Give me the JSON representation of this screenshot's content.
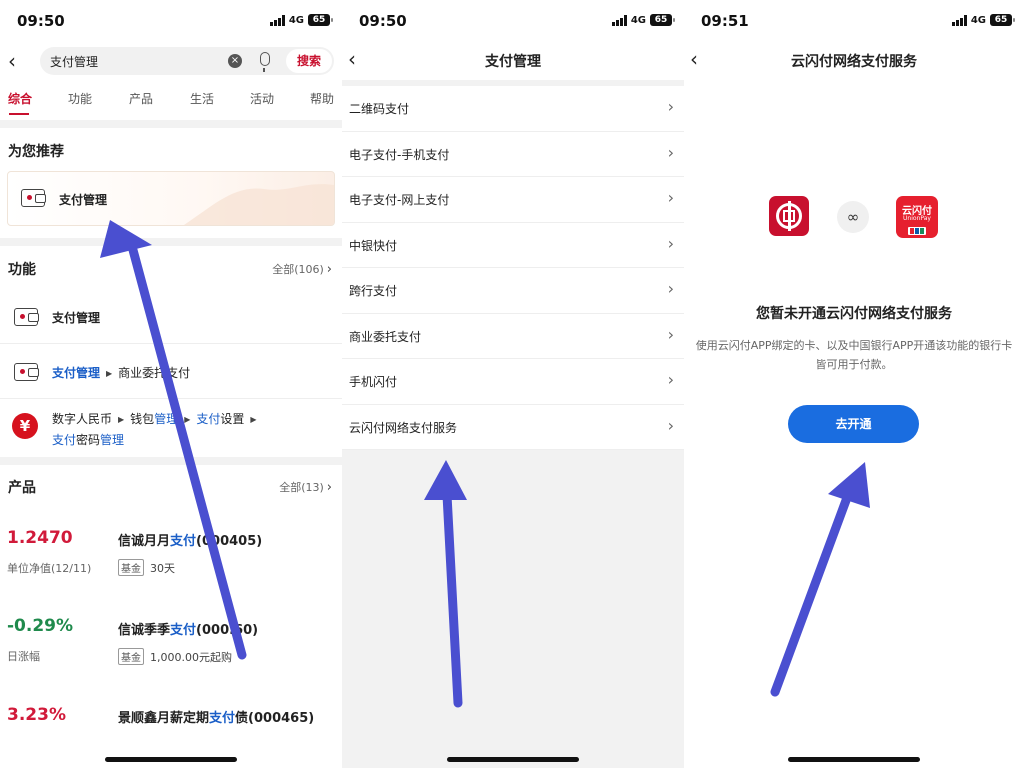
{
  "panel1": {
    "status": {
      "time": "09:50",
      "network": "4G",
      "battery": "65"
    },
    "search": {
      "query": "支付管理",
      "clear": "×",
      "button": "搜索"
    },
    "tabs": [
      "综合",
      "功能",
      "产品",
      "生活",
      "活动",
      "帮助"
    ],
    "recommend": {
      "title": "为您推荐",
      "item": "支付管理"
    },
    "functions": {
      "title": "功能",
      "more": "全部(106)",
      "item1": "支付管理",
      "item2": {
        "a": "支付管理",
        "b": "商业委托支付"
      },
      "item3": {
        "a1": "数字人民币",
        "b1": "钱包",
        "b2": "管理",
        "c1": "支付",
        "c2": "设置",
        "d1": "支付",
        "d2": "密码",
        "d3": "管理"
      },
      "yuan_glyph": "¥"
    },
    "products": {
      "title": "产品",
      "more": "全部(13)",
      "items": [
        {
          "value": "1.2470",
          "sub": "单位净值(12/11)",
          "name_a": "信诚月月",
          "name_b": "支付",
          "name_c": "(000405)",
          "tag": "基金",
          "tag_text": "30天"
        },
        {
          "value": "-0.29%",
          "sub": "日涨幅",
          "name_a": "信诚季季",
          "name_b": "支付",
          "name_c": "(000.60)",
          "tag": "基金",
          "tag_text": "1,000.00元起购"
        },
        {
          "value": "3.23%",
          "sub": "",
          "name_a": "景顺鑫月薪定期",
          "name_b": "支付",
          "name_c": "债(000465)",
          "tag": "",
          "tag_text": ""
        }
      ]
    }
  },
  "panel2": {
    "status": {
      "time": "09:50",
      "network": "4G",
      "battery": "65"
    },
    "title": "支付管理",
    "items": [
      "二维码支付",
      "电子支付-手机支付",
      "电子支付-网上支付",
      "中银快付",
      "跨行支付",
      "商业委托支付",
      "手机闪付",
      "云闪付网络支付服务"
    ]
  },
  "panel3": {
    "status": {
      "time": "09:51",
      "network": "4G",
      "battery": "65"
    },
    "title": "云闪付网络支付服务",
    "logo_cn": "云闪付",
    "logo_en": "UnionPay",
    "heading": "您暂未开通云闪付网络支付服务",
    "description": "使用云闪付APP绑定的卡、以及中国银行APP开通该功能的银行卡皆可用于付款。",
    "button": "去开通"
  },
  "colors": {
    "brand_red": "#c8102e",
    "link_blue": "#1a5ec7",
    "button_blue": "#1a6de0",
    "arrow": "#4a4fd0",
    "negative_green": "#1f8a4c"
  }
}
